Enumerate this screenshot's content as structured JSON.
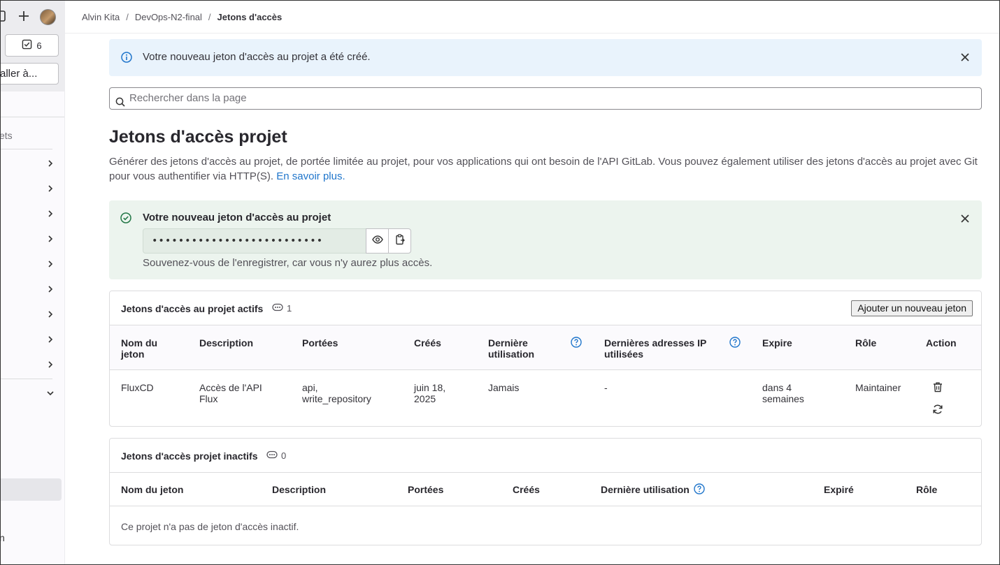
{
  "sidebar": {
    "todo_count": "6",
    "goto_label": "aller à...",
    "partial_label_1": "ets",
    "partial_label_2": "n"
  },
  "breadcrumb": {
    "items": [
      "Alvin Kita",
      "DevOps-N2-final"
    ],
    "current": "Jetons d'accès",
    "separator": "/"
  },
  "info_alert": {
    "text": "Votre nouveau jeton d'accès au projet a été créé."
  },
  "search": {
    "placeholder": "Rechercher dans la page"
  },
  "page": {
    "title": "Jetons d'accès projet",
    "description": "Générer des jetons d'accès au projet, de portée limitée au projet, pour vos applications qui ont besoin de l'API GitLab. Vous pouvez également utiliser des jetons d'accès au projet avec Git pour vous authentifier via HTTP(S).",
    "learn_more": "En savoir plus."
  },
  "new_token": {
    "title": "Votre nouveau jeton d'accès au projet",
    "masked_value": "••••••••••••••••••••••••••",
    "hint": "Souvenez-vous de l'enregistrer, car vous n'y aurez plus accès."
  },
  "active_tokens": {
    "title": "Jetons d'accès au projet actifs",
    "count": "1",
    "add_button": "Ajouter un nouveau jeton",
    "columns": {
      "name": "Nom du jeton",
      "description": "Description",
      "scopes": "Portées",
      "created": "Créés",
      "last_used": "Dernière utilisation",
      "last_ips": "Dernières adresses IP utilisées",
      "expires": "Expire",
      "role": "Rôle",
      "action": "Action"
    },
    "rows": [
      {
        "name": "FluxCD",
        "description": "Accès de l'API Flux",
        "scopes": "api, write_repository",
        "created": "juin 18, 2025",
        "last_used": "Jamais",
        "last_ips": "-",
        "expires": "dans 4 semaines",
        "role": "Maintainer"
      }
    ]
  },
  "inactive_tokens": {
    "title": "Jetons d'accès projet inactifs",
    "count": "0",
    "columns": {
      "name": "Nom du jeton",
      "description": "Description",
      "scopes": "Portées",
      "created": "Créés",
      "last_used": "Dernière utilisation",
      "expired": "Expiré",
      "role": "Rôle"
    },
    "empty": "Ce projet n'a pas de jeton d'accès inactif."
  }
}
